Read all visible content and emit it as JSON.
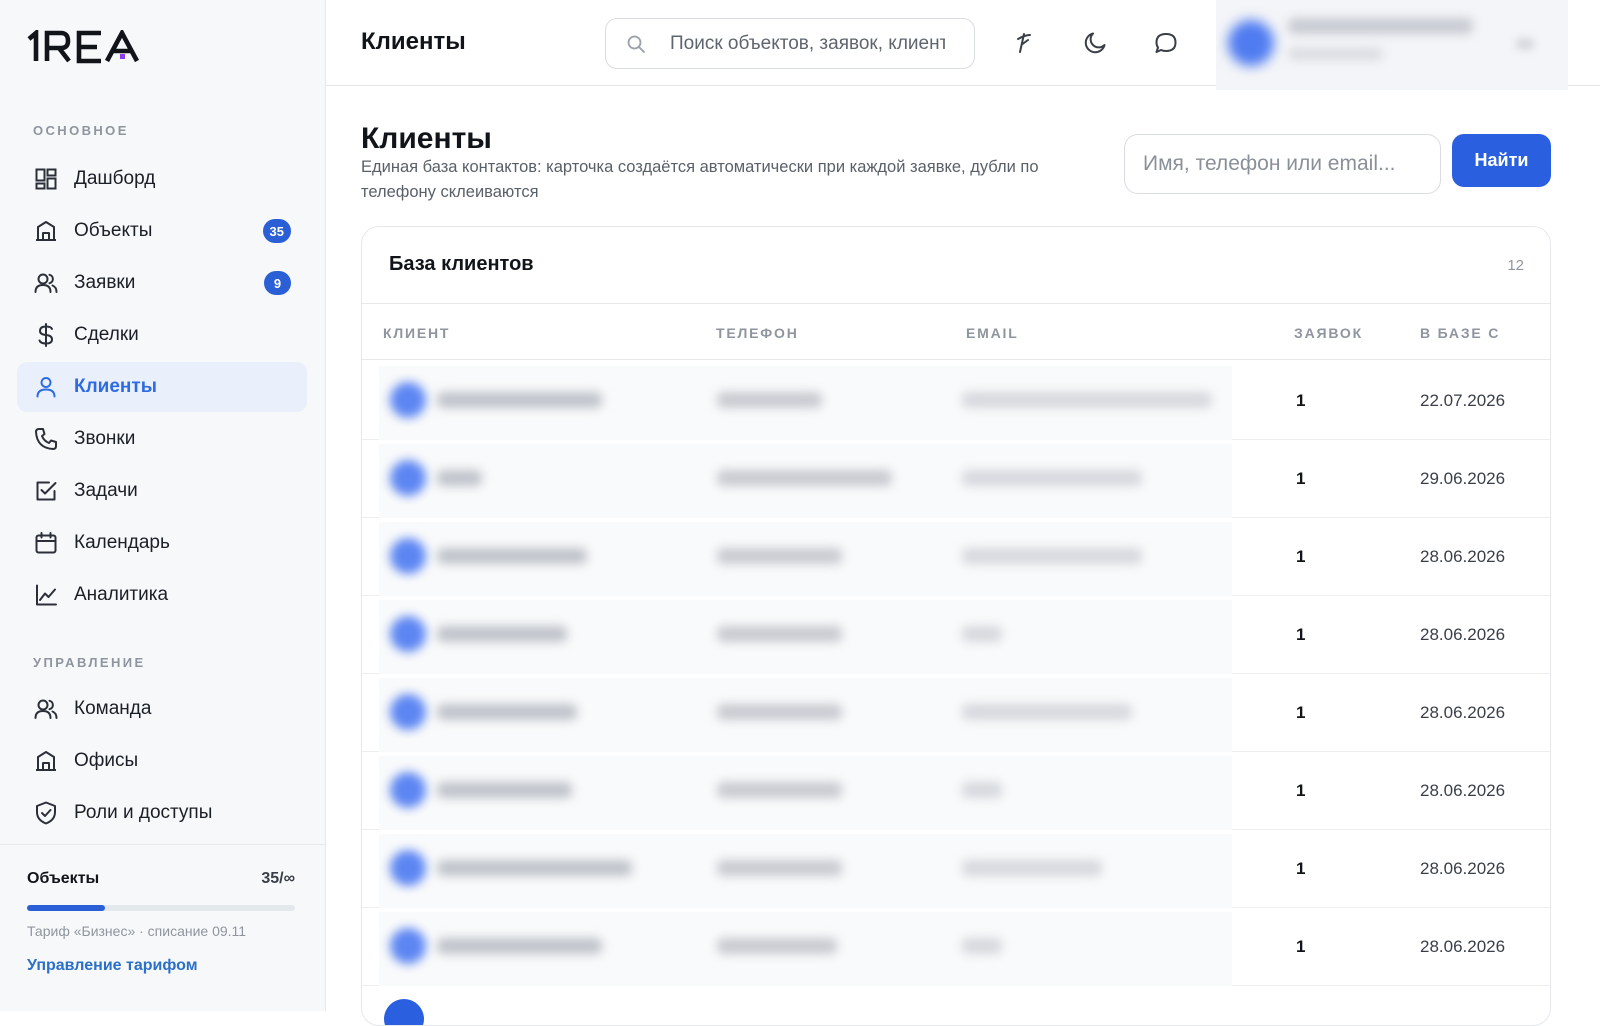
{
  "app": {
    "logo_text": "1REA"
  },
  "sidebar": {
    "sections": [
      {
        "label": "ОСНОВНОЕ"
      },
      {
        "label": "УПРАВЛЕНИЕ"
      }
    ],
    "items": [
      {
        "label": "Дашборд",
        "icon": "dashboard-icon"
      },
      {
        "label": "Объекты",
        "icon": "building-icon",
        "badge": "35"
      },
      {
        "label": "Заявки",
        "icon": "users-icon",
        "badge": "9"
      },
      {
        "label": "Сделки",
        "icon": "dollar-icon"
      },
      {
        "label": "Клиенты",
        "icon": "user-icon",
        "active": true
      },
      {
        "label": "Звонки",
        "icon": "phone-icon"
      },
      {
        "label": "Задачи",
        "icon": "checkbox-icon"
      },
      {
        "label": "Календарь",
        "icon": "calendar-icon"
      },
      {
        "label": "Аналитика",
        "icon": "chart-line-icon"
      },
      {
        "label": "Команда",
        "icon": "users-icon"
      },
      {
        "label": "Офисы",
        "icon": "building-icon"
      },
      {
        "label": "Роли и доступы",
        "icon": "shield-icon"
      }
    ],
    "footer": {
      "quota_title": "Объекты",
      "quota_count": "35/∞",
      "quota_fill_fraction": 0.29,
      "tariff_note": "Тариф «Бизнес» · списание 09.11",
      "tariff_link": "Управление тарифом"
    }
  },
  "topbar": {
    "title": "Клиенты",
    "search_placeholder": "Поиск объектов, заявок, клиентов",
    "icons": [
      "broom-icon",
      "moon-icon",
      "chat-icon"
    ]
  },
  "main": {
    "title": "Клиенты",
    "subtitle": "Единая база контактов: карточка создаётся автоматически при каждой заявке, дубли по телефону склеиваются",
    "filter_placeholder": "Имя, телефон или email...",
    "find_label": "Найти",
    "card": {
      "title": "База клиентов",
      "count": "12",
      "columns": [
        "КЛИЕНТ",
        "ТЕЛЕФОН",
        "EMAIL",
        "ЗАЯВОК",
        "В БАЗЕ С"
      ],
      "rows": [
        {
          "requests": "1",
          "since": "22.07.2026"
        },
        {
          "requests": "1",
          "since": "29.06.2026"
        },
        {
          "requests": "1",
          "since": "28.06.2026"
        },
        {
          "requests": "1",
          "since": "28.06.2026"
        },
        {
          "requests": "1",
          "since": "28.06.2026"
        },
        {
          "requests": "1",
          "since": "28.06.2026"
        },
        {
          "requests": "1",
          "since": "28.06.2026"
        },
        {
          "requests": "1",
          "since": "28.06.2026"
        }
      ]
    }
  },
  "colors": {
    "accent": "#2a5fe0",
    "active_bg": "#eaf0fb",
    "badge": "#2a5fd6",
    "link": "#2a6fc9"
  }
}
